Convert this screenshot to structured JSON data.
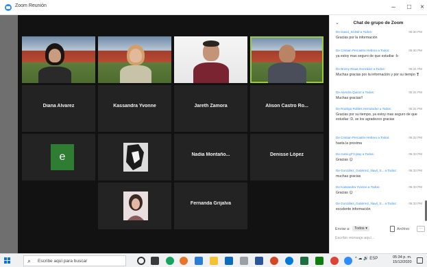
{
  "window": {
    "title": "Zoom Reunión",
    "minimize": "–",
    "maximize": "□",
    "close": "×"
  },
  "gallery": {
    "participants": [
      {
        "name": "Diana Alvarez"
      },
      {
        "name": "Kassandra Yvonne"
      },
      {
        "name": "Jareth Zamora"
      },
      {
        "name": "Alison Castro Ro..."
      },
      {
        "name": "e"
      },
      {
        "name": "Nadia Montaño..."
      },
      {
        "name": "Denisse López"
      },
      {
        "name": "Fernanda Grijalva"
      }
    ]
  },
  "chat": {
    "collapse": "⌄",
    "title": "Chat de grupo de Zoom",
    "messages": [
      {
        "from": "De David_SCMZ a Todos:",
        "time": "05:30 PM",
        "text": "Gracias por la información"
      },
      {
        "from": "De Cristian Percastre Hebreo a Todos:",
        "time": "05:30 PM",
        "text": "ya estoy mas seguro de que estudiar :b"
      },
      {
        "from": "De Brizny Rivas González a Todos:",
        "time": "05:31 PM",
        "text": "Muchas gracias por la información y por su tiempo ❣"
      },
      {
        "from": "De Alondra Quiroz a Todos:",
        "time": "05:31 PM",
        "text": "Muchas gracias!!"
      },
      {
        "from": "De Rodrigo Robles Hernández a Todos:",
        "time": "05:31 PM",
        "text": "Gracias por su tiempo, ya estoy mas seguro de que estudiar :D, se los agradezco gracias"
      },
      {
        "from": "De Cristian Percastre Hebreo a Todos:",
        "time": "05:32 PM",
        "text": "hasta la proxima"
      },
      {
        "from": "De mxtsi gt^3 play a Todos:",
        "time": "05:33 PM",
        "text": "Gracias 😊"
      },
      {
        "from": "De González_Gutiérrez_Navil_S... a Todos:",
        "time": "05:33 PM",
        "text": "muchas gracias"
      },
      {
        "from": "De Kassandra Yvonne a Todos:",
        "time": "05:33 PM",
        "text": "Gracias 😊"
      },
      {
        "from": "De González_Gutiérrez_Navil_S... a Todos:",
        "time": "05:33 PM",
        "text": "excelente información"
      }
    ],
    "send_to_label": "Enviar a:",
    "send_to_value": "Todos ▾",
    "file_label": "Archivo",
    "more": "···",
    "input_placeholder": "Escribir mensaje aquí..."
  },
  "taskbar": {
    "search_placeholder": "Escribe aquí para buscar",
    "tray": "^ ☁ 🔊 ESP",
    "time": "05:34 p. m.",
    "date": "15/12/2020"
  }
}
